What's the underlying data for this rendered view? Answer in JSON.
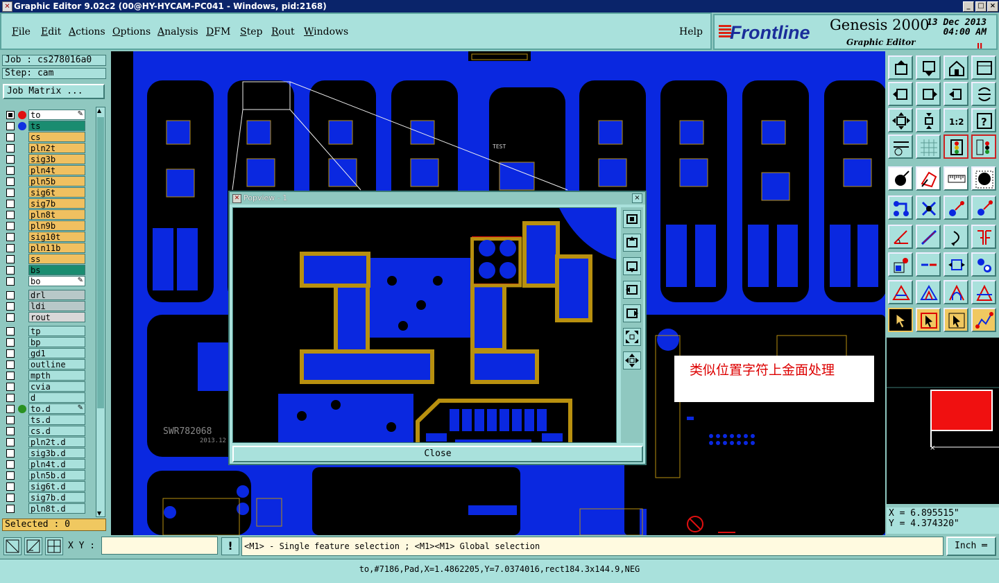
{
  "window": {
    "title": "Graphic Editor 9.02c2 (00@HY-HYCAM-PC041 - Windows, pid:2168)",
    "min_glyph": "_",
    "max_glyph": "□",
    "close_glyph": "×"
  },
  "menu": {
    "items": [
      {
        "label": "File",
        "u": "F",
        "rest": "ile"
      },
      {
        "label": "Edit",
        "u": "E",
        "rest": "dit"
      },
      {
        "label": "Actions",
        "u": "A",
        "rest": "ctions"
      },
      {
        "label": "Options",
        "u": "O",
        "rest": "ptions"
      },
      {
        "label": "Analysis",
        "u": "A",
        "rest": "nalysis"
      },
      {
        "label": "DFM",
        "u": "D",
        "rest": "FM"
      },
      {
        "label": "Step",
        "u": "S",
        "rest": "tep"
      },
      {
        "label": "Rout",
        "u": "R",
        "rest": "out"
      },
      {
        "label": "Windows",
        "u": "W",
        "rest": "indows"
      }
    ],
    "help": "Help"
  },
  "logo": {
    "brand": "Frontline",
    "product": "Genesis 2000",
    "subtitle": "Graphic Editor",
    "date": "13 Dec 2013",
    "time": "04:00 AM",
    "indicator": "II"
  },
  "left": {
    "job": "Job : cs278016a0",
    "step": "Step: cam",
    "job_matrix": "Job Matrix ...",
    "selected": "Selected : 0"
  },
  "layers": [
    {
      "name": "to",
      "color": "#ffffff",
      "dot": "#e01010",
      "checked": true,
      "mark": "✎"
    },
    {
      "name": "ts",
      "color": "#1a8c70",
      "dot": "#1030e0",
      "checked": false,
      "mark": ""
    },
    {
      "name": "cs",
      "color": "#f0c060",
      "dot": "",
      "checked": false,
      "mark": ""
    },
    {
      "name": "pln2t",
      "color": "#f0c060",
      "dot": "",
      "checked": false,
      "mark": ""
    },
    {
      "name": "sig3b",
      "color": "#f0c060",
      "dot": "",
      "checked": false,
      "mark": ""
    },
    {
      "name": "pln4t",
      "color": "#f0c060",
      "dot": "",
      "checked": false,
      "mark": ""
    },
    {
      "name": "pln5b",
      "color": "#f0c060",
      "dot": "",
      "checked": false,
      "mark": ""
    },
    {
      "name": "sig6t",
      "color": "#f0c060",
      "dot": "",
      "checked": false,
      "mark": ""
    },
    {
      "name": "sig7b",
      "color": "#f0c060",
      "dot": "",
      "checked": false,
      "mark": ""
    },
    {
      "name": "pln8t",
      "color": "#f0c060",
      "dot": "",
      "checked": false,
      "mark": ""
    },
    {
      "name": "pln9b",
      "color": "#f0c060",
      "dot": "",
      "checked": false,
      "mark": ""
    },
    {
      "name": "sig10t",
      "color": "#f0c060",
      "dot": "",
      "checked": false,
      "mark": ""
    },
    {
      "name": "pln11b",
      "color": "#f0c060",
      "dot": "",
      "checked": false,
      "mark": ""
    },
    {
      "name": "ss",
      "color": "#f0c060",
      "dot": "",
      "checked": false,
      "mark": ""
    },
    {
      "name": "bs",
      "color": "#1a8c70",
      "dot": "",
      "checked": false,
      "mark": ""
    },
    {
      "name": "bo",
      "color": "#ffffff",
      "dot": "",
      "checked": false,
      "mark": "✎"
    },
    {
      "name": "drl",
      "color": "#b8c8c8",
      "dot": "",
      "checked": false,
      "mark": ""
    },
    {
      "name": "ldi",
      "color": "#b8c8c8",
      "dot": "",
      "checked": false,
      "mark": ""
    },
    {
      "name": "rout",
      "color": "#d8d8d8",
      "dot": "",
      "checked": false,
      "mark": ""
    },
    {
      "name": "tp",
      "color": "#a9e1dc",
      "dot": "",
      "checked": false,
      "mark": ""
    },
    {
      "name": "bp",
      "color": "#a9e1dc",
      "dot": "",
      "checked": false,
      "mark": ""
    },
    {
      "name": "gd1",
      "color": "#a9e1dc",
      "dot": "",
      "checked": false,
      "mark": ""
    },
    {
      "name": "outline",
      "color": "#a9e1dc",
      "dot": "",
      "checked": false,
      "mark": ""
    },
    {
      "name": "mpth",
      "color": "#a9e1dc",
      "dot": "",
      "checked": false,
      "mark": ""
    },
    {
      "name": "cvia",
      "color": "#a9e1dc",
      "dot": "",
      "checked": false,
      "mark": ""
    },
    {
      "name": "d",
      "color": "#a9e1dc",
      "dot": "",
      "checked": false,
      "mark": ""
    },
    {
      "name": "to.d",
      "color": "#a9e1dc",
      "dot": "#2a9020",
      "checked": false,
      "mark": "✎"
    },
    {
      "name": "ts.d",
      "color": "#a9e1dc",
      "dot": "",
      "checked": false,
      "mark": ""
    },
    {
      "name": "cs.d",
      "color": "#a9e1dc",
      "dot": "",
      "checked": false,
      "mark": ""
    },
    {
      "name": "pln2t.d",
      "color": "#a9e1dc",
      "dot": "",
      "checked": false,
      "mark": ""
    },
    {
      "name": "sig3b.d",
      "color": "#a9e1dc",
      "dot": "",
      "checked": false,
      "mark": ""
    },
    {
      "name": "pln4t.d",
      "color": "#a9e1dc",
      "dot": "",
      "checked": false,
      "mark": ""
    },
    {
      "name": "pln5b.d",
      "color": "#a9e1dc",
      "dot": "",
      "checked": false,
      "mark": ""
    },
    {
      "name": "sig6t.d",
      "color": "#a9e1dc",
      "dot": "",
      "checked": false,
      "mark": ""
    },
    {
      "name": "sig7b.d",
      "color": "#a9e1dc",
      "dot": "",
      "checked": false,
      "mark": ""
    },
    {
      "name": "pln8t.d",
      "color": "#a9e1dc",
      "dot": "",
      "checked": false,
      "mark": ""
    }
  ],
  "canvas": {
    "silk_text": "SWR782068",
    "silk_date": "2013.12",
    "test_label": "TEST"
  },
  "popview": {
    "title": "Popview - 1",
    "close_glyph": "×",
    "close_label": "Close"
  },
  "note": "类似位置字符上金面处理",
  "readout": {
    "x": "X = 6.895515\"",
    "y": "Y = 4.374320\""
  },
  "bottom": {
    "xy_label": "X Y :",
    "xy_value": "",
    "excl": "!",
    "hint": "<M1> - Single feature selection ; <M1><M1> Global selection",
    "unit": "Inch",
    "unit_arrow": "═"
  },
  "status": "to,#7186,Pad,X=1.4862205,Y=7.0374016,rect184.3x144.9,NEG",
  "colors": {
    "teal": "#a9e1dc",
    "board_blue": "#0a28e0",
    "gold": "#b8900f",
    "red": "#e01010"
  }
}
